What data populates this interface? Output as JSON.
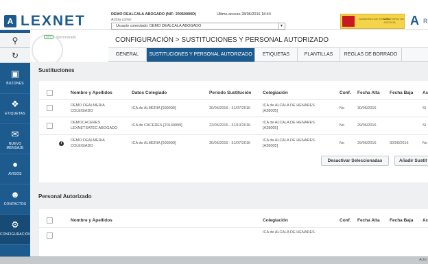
{
  "app": {
    "logo_letter": "A",
    "logo_text": "LEXNET",
    "user_line1": "DEMO DEALCALA ABOGADO (NIF: 20050000D)",
    "user_line2": "Actúa como:",
    "last_access": "Último acceso 28/06/2016 18:44",
    "user_select": "Usuario conectado: DEMO DEALCALA ABOGADO",
    "ministry_text": "GOBIERNO DE ESPAÑA",
    "ministry_text2": "MINISTERIO DE JUSTICIA"
  },
  "toolbar": {
    "search_icon": "search-icon",
    "refresh_icon": "refresh-icon"
  },
  "sidebar": {
    "items": [
      {
        "label": "BUZONES",
        "icon": "inbox-icon"
      },
      {
        "label": "ETIQUETAS",
        "icon": "tag-icon"
      },
      {
        "label": "NUEVO MENSAJE",
        "icon": "envelope-icon"
      },
      {
        "label": "AVISOS",
        "icon": "alert-icon"
      },
      {
        "label": "CONTACTOS",
        "icon": "contacts-icon"
      },
      {
        "label": "CONFIGURACIÓN",
        "icon": "gear-icon"
      }
    ]
  },
  "sync": {
    "badge": "OFF",
    "text": "Sincronizado"
  },
  "header": {
    "title": "CONFIGURACIÓN  >  SUSTITUCIONES Y PERSONAL AUTORIZADO"
  },
  "tabs": [
    {
      "label": "GENERAL"
    },
    {
      "label": "SUSTITUCIONES Y PERSONAL AUTORIZADO"
    },
    {
      "label": "ETIQUETAS"
    },
    {
      "label": "PLANTILLAS"
    },
    {
      "label": "REGLAS DE BORRADO"
    }
  ],
  "sustituciones": {
    "title": "Sustituciones",
    "columns": [
      "Nombre y Apellidos",
      "Datos Colegiado",
      "Periodo Sustitución",
      "Colegiación",
      "Conf.",
      "Fecha Alta",
      "Fecha Baja",
      "Ac"
    ],
    "rows": [
      {
        "nombre1": "DEMO DEALMERIA",
        "nombre2": "COLEGIADO",
        "datos": "ICA de ALMERIA [999999]",
        "periodo": "30/06/2016 - 31/07/2016",
        "coleg1": "ICA de ALCALA DE HENARES",
        "coleg2": "[A28005]",
        "conf": "No",
        "alta": "30/06/2016",
        "baja": "",
        "ac": "Sí"
      },
      {
        "nombre1": "DEMOCACERES",
        "nombre2": "LEXNETSATEC ABOGADO",
        "datos": "ICA de CACERES [20149999]",
        "periodo": "22/06/2016 - 31/10/2016",
        "coleg1": "ICA de ALCALA DE HENARES",
        "coleg2": "[A28005]",
        "conf": "No",
        "alta": "29/06/2016",
        "baja": "",
        "ac": "Sí"
      },
      {
        "nombre1": "DEMO DEALMERIA",
        "nombre2": "COLEGIADO",
        "datos": "ICA de ALMERIA [999999]",
        "periodo": "30/06/2016 - 31/07/2016",
        "coleg1": "ICA de ALCALA DE HENARES",
        "coleg2": "[A28005]",
        "conf": "No",
        "alta": "29/06/2016",
        "baja": "30/06/2016",
        "ac": "No"
      }
    ],
    "btn_deactivate": "Desactivar Seleccionadas",
    "btn_add": "Añadir Sustit"
  },
  "personal": {
    "title": "Personal Autorizado",
    "columns": [
      "Nombre y Apellidos",
      "Colegiación",
      "Conf.",
      "Fecha Alta",
      "Fecha Baja",
      "Ac"
    ],
    "partial_row": "ICA de ALCALA DE HENARES"
  },
  "bottombar": {
    "text": "Activ"
  }
}
